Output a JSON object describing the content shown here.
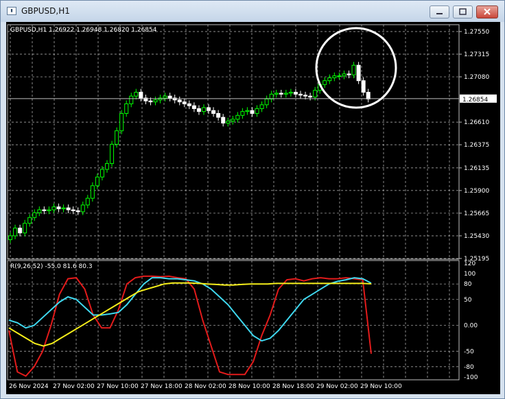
{
  "window": {
    "title": "GBPUSD,H1",
    "app_icon": "chart-window-icon",
    "buttons": {
      "minimize_icon": "minimize-icon",
      "maximize_icon": "maximize-icon",
      "close_icon": "close-icon"
    }
  },
  "chart": {
    "header": "GBPUSD,H1  1.26922 1.26948 1.26820 1.26854",
    "current_price_label": "1.26854",
    "colors": {
      "background": "#000000",
      "grid": "#c0c0c0",
      "bull": "#00ff00",
      "bear": "#ffffff",
      "price_line": "#c0c0c0"
    },
    "annotation": {
      "shape": "circle",
      "color": "#ffffff",
      "target": "last candles"
    }
  },
  "indicator": {
    "label": "R(9,26,52) -55.0 81.6 80.3",
    "colors": {
      "red": "#e31b1b",
      "cyan": "#3fd8ef",
      "yellow": "#f5ee1a"
    }
  },
  "chart_data": [
    {
      "type": "candlestick",
      "symbol": "GBPUSD",
      "timeframe": "H1",
      "ohlc_last": {
        "open": 1.26922,
        "high": 1.26948,
        "low": 1.2682,
        "close": 1.26854
      },
      "ylim": [
        1.25195,
        1.2755
      ],
      "y_ticks": [
        "1.27550",
        "1.27315",
        "1.27080",
        "1.26610",
        "1.26375",
        "1.26135",
        "1.25900",
        "1.25665",
        "1.25430",
        "1.25195"
      ],
      "x_ticks": [
        "26 Nov 2024",
        "27 Nov 02:00",
        "27 Nov 10:00",
        "27 Nov 18:00",
        "28 Nov 02:00",
        "28 Nov 10:00",
        "28 Nov 18:00",
        "29 Nov 02:00",
        "29 Nov 10:00"
      ],
      "close": [
        1.2543,
        1.2551,
        1.2546,
        1.2556,
        1.2562,
        1.2567,
        1.257,
        1.2569,
        1.257,
        1.2573,
        1.2571,
        1.2572,
        1.257,
        1.2569,
        1.2568,
        1.2575,
        1.2582,
        1.2595,
        1.2604,
        1.2612,
        1.2618,
        1.2638,
        1.2652,
        1.267,
        1.268,
        1.2688,
        1.2692,
        1.2686,
        1.2683,
        1.2682,
        1.2684,
        1.2686,
        1.2688,
        1.2686,
        1.2684,
        1.2682,
        1.268,
        1.2678,
        1.2675,
        1.2672,
        1.2676,
        1.2673,
        1.267,
        1.2666,
        1.266,
        1.2662,
        1.2664,
        1.2668,
        1.2672,
        1.2673,
        1.267,
        1.2675,
        1.2679,
        1.2685,
        1.269,
        1.2691,
        1.269,
        1.2691,
        1.2692,
        1.269,
        1.2689,
        1.2688,
        1.2687,
        1.2694,
        1.27,
        1.2704,
        1.2707,
        1.2709,
        1.2709,
        1.2711,
        1.271,
        1.272,
        1.2704,
        1.2692,
        1.2685
      ]
    },
    {
      "type": "line",
      "title": "R(9,26,52)",
      "ylim": [
        -100,
        120
      ],
      "y_ticks": [
        "120",
        "100",
        "80",
        "50",
        "0.00",
        "-50",
        "-80",
        "-100"
      ],
      "last_values": [
        -55.0,
        81.6,
        80.3
      ],
      "series": [
        {
          "color": "#e31b1b",
          "values": [
            -10,
            -90,
            -98,
            -80,
            -50,
            0,
            60,
            90,
            92,
            70,
            20,
            -5,
            -5,
            30,
            80,
            92,
            95,
            95,
            94,
            95,
            92,
            90,
            70,
            10,
            -40,
            -90,
            -95,
            -95,
            -95,
            -70,
            -20,
            20,
            70,
            88,
            90,
            86,
            90,
            92,
            90,
            90,
            92,
            90,
            88,
            -55
          ]
        },
        {
          "color": "#3fd8ef",
          "values": [
            10,
            5,
            -5,
            0,
            15,
            30,
            45,
            55,
            50,
            35,
            20,
            20,
            22,
            25,
            40,
            60,
            80,
            92,
            92,
            90,
            90,
            88,
            86,
            80,
            70,
            55,
            40,
            20,
            0,
            -20,
            -30,
            -25,
            -10,
            10,
            30,
            50,
            60,
            70,
            80,
            85,
            88,
            92,
            90,
            81.6
          ]
        },
        {
          "color": "#f5ee1a",
          "values": [
            -5,
            -15,
            -25,
            -35,
            -40,
            -35,
            -25,
            -15,
            -5,
            5,
            15,
            25,
            35,
            45,
            55,
            65,
            70,
            75,
            80,
            82,
            82,
            82,
            81,
            80,
            79,
            78,
            78,
            79,
            80,
            80,
            80,
            81,
            81,
            81,
            81,
            81,
            81,
            81,
            81,
            81,
            81,
            81,
            80.3
          ]
        }
      ]
    }
  ]
}
